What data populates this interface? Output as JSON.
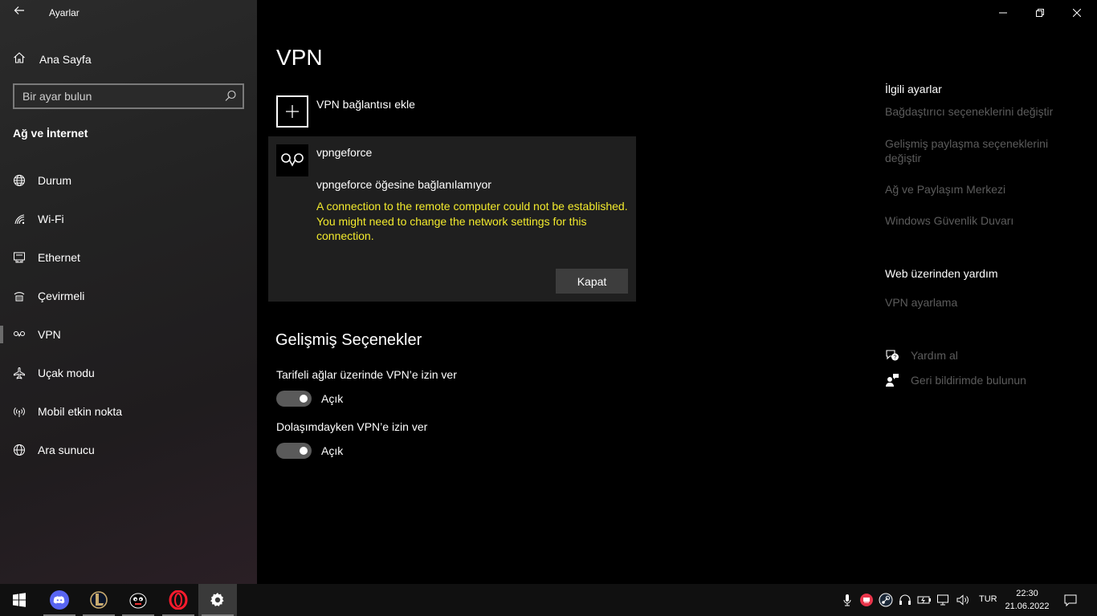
{
  "window": {
    "title": "Ayarlar"
  },
  "sidebar": {
    "home_label": "Ana Sayfa",
    "search_placeholder": "Bir ayar bulun",
    "section_title": "Ağ ve İnternet",
    "items": [
      {
        "label": "Durum",
        "icon": "globe-status-icon"
      },
      {
        "label": "Wi-Fi",
        "icon": "wifi-icon"
      },
      {
        "label": "Ethernet",
        "icon": "ethernet-icon"
      },
      {
        "label": "Çevirmeli",
        "icon": "dialup-icon"
      },
      {
        "label": "VPN",
        "icon": "vpn-icon",
        "active": true
      },
      {
        "label": "Uçak modu",
        "icon": "airplane-icon"
      },
      {
        "label": "Mobil etkin nokta",
        "icon": "hotspot-icon"
      },
      {
        "label": "Ara sunucu",
        "icon": "proxy-globe-icon"
      }
    ]
  },
  "main": {
    "title": "VPN",
    "add_vpn_label": "VPN bağlantısı ekle",
    "connection": {
      "name": "vpngeforce",
      "status": "vpngeforce öğesine bağlanılamıyor",
      "error": "A connection to the remote computer could not be established.  You might need to change the network settings for this connection.",
      "close_label": "Kapat"
    },
    "advanced": {
      "title": "Gelişmiş Seçenekler",
      "options": [
        {
          "label": "Tarifeli ağlar üzerinde VPN’e izin ver",
          "state": "Açık",
          "on": true
        },
        {
          "label": "Dolaşımdayken VPN’e izin ver",
          "state": "Açık",
          "on": true
        }
      ]
    }
  },
  "related": {
    "title": "İlgili ayarlar",
    "links": [
      "Bağdaştırıcı seçeneklerini değiştir",
      "Gelişmiş paylaşma seçeneklerini değiştir",
      "Ağ ve Paylaşım Merkezi",
      "Windows Güvenlik Duvarı"
    ],
    "web_help_title": "Web üzerinden yardım",
    "web_help_links": [
      "VPN ayarlama"
    ],
    "help_label": "Yardım al",
    "feedback_label": "Geri bildirimde bulunun"
  },
  "taskbar": {
    "apps": [
      "windows-start",
      "discord",
      "league-of-legends",
      "game-client",
      "opera",
      "settings"
    ],
    "language": "TUR",
    "time": "22:30",
    "date": "21.06.2022"
  },
  "colors": {
    "error_text": "#f2ea2d",
    "muted_link": "#5c5c5c",
    "toggle_on": "#5a5a5a"
  }
}
